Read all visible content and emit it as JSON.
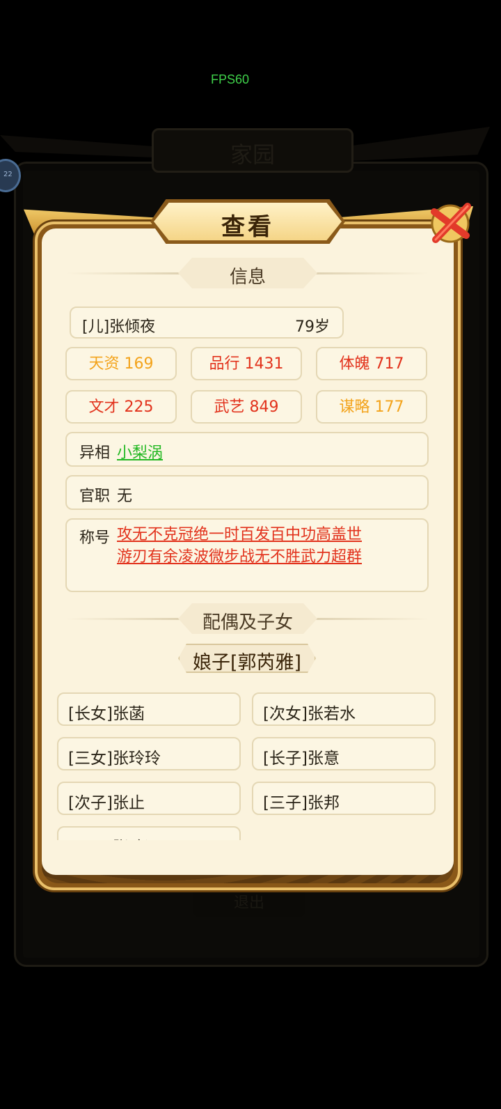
{
  "fps_label": "FPS60",
  "background": {
    "title": "家园",
    "button_label": "退出",
    "avatar_badge": "22"
  },
  "popup": {
    "title": "查看",
    "info_section": "信息",
    "person": {
      "name": "[儿]张倾夜",
      "age": "79岁"
    },
    "stats": [
      {
        "label": "天资 169",
        "color": "#f3a31b"
      },
      {
        "label": "品行 1431",
        "color": "#e2321c"
      },
      {
        "label": "体魄 717",
        "color": "#e2321c"
      },
      {
        "label": "文才 225",
        "color": "#e2321c"
      },
      {
        "label": "武艺 849",
        "color": "#e2321c"
      },
      {
        "label": "谋略 177",
        "color": "#f3a31b"
      }
    ],
    "trait": {
      "label": "异相",
      "value": "小梨涡"
    },
    "office": {
      "label": "官职",
      "value": "无"
    },
    "titles": {
      "label": "称号",
      "line1": "攻无不克冠绝一时百发百中功高盖世",
      "line2": "游刃有余凌波微步战无不胜武力超群"
    },
    "family_section": "配偶及子女",
    "spouse": "娘子[郭芮雅]",
    "children": [
      "[长女]张菡",
      "[次女]张若水",
      "[三女]张玲玲",
      "[长子]张意",
      "[次子]张止",
      "[三子]张邦",
      "[四子]张致远"
    ]
  }
}
